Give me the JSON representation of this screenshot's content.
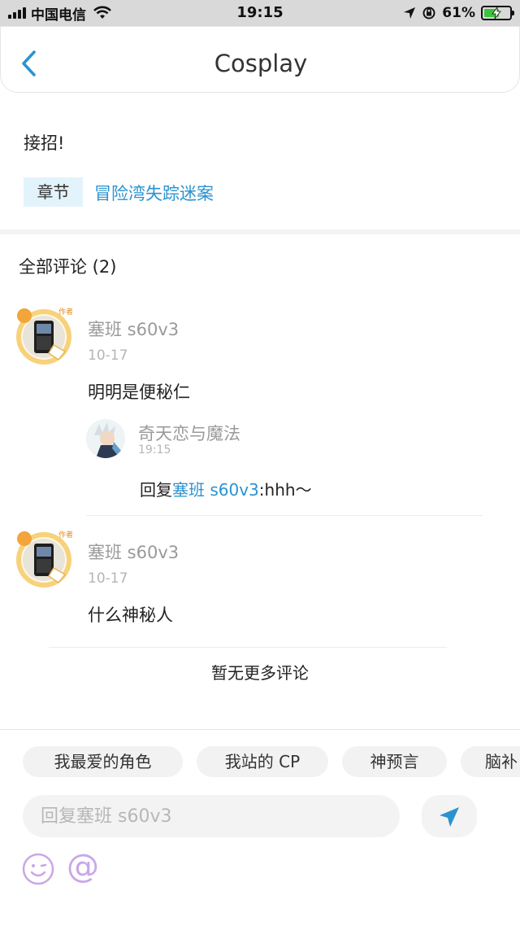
{
  "status_bar": {
    "carrier": "中国电信",
    "time": "19:15",
    "battery_percent": "61%",
    "battery_level": 0.61,
    "icons": [
      "signal-icon",
      "wifi-icon",
      "location-icon",
      "orientation-lock-icon",
      "battery-charging-icon"
    ]
  },
  "header": {
    "back_icon": "chevron-left-icon",
    "title": "Cosplay"
  },
  "post": {
    "text": "接招!",
    "chapter_tag": "章节",
    "chapter_link": "冒险湾失踪迷案"
  },
  "comments": {
    "title": "全部评论 (2)",
    "items": [
      {
        "user": "塞班 s60v3",
        "date": "10-17",
        "text": "明明是便秘仁",
        "badge": "作者",
        "reply": {
          "user": "奇天恋与魔法",
          "time": "19:15",
          "prefix": "回复",
          "mention": "塞班 s60v3",
          "text": ":hhh～"
        }
      },
      {
        "user": "塞班 s60v3",
        "date": "10-17",
        "text": "什么神秘人",
        "badge": "作者"
      }
    ],
    "no_more": "暂无更多评论"
  },
  "bottom": {
    "chips": [
      "我最爱的角色",
      "我站的 CP",
      "神预言",
      "脑补"
    ],
    "reply_placeholder": "回复塞班 s60v3",
    "send_icon": "send-icon",
    "emoji_icon": "emoji-icon",
    "at_icon_label": "@",
    "accent_color": "#2a93cf"
  }
}
